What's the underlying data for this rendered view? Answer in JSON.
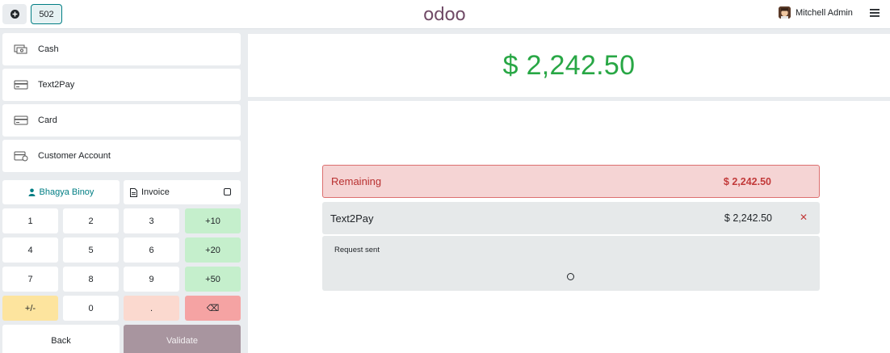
{
  "topbar": {
    "order_tab": "502",
    "logo": "odoo",
    "user_name": "Mitchell Admin",
    "icons": {
      "new_order": "plus-circle-icon",
      "menu": "hamburger-menu-icon",
      "avatar": "user-avatar"
    }
  },
  "payment_methods": [
    {
      "label": "Cash",
      "icon": "cash-register-icon"
    },
    {
      "label": "Text2Pay",
      "icon": "card-icon"
    },
    {
      "label": "Card",
      "icon": "card-icon"
    },
    {
      "label": "Customer Account",
      "icon": "customer-account-icon"
    }
  ],
  "customer": {
    "name": "Bhagya Binoy",
    "icon": "user-icon"
  },
  "invoice": {
    "label": "Invoice",
    "icon": "document-icon",
    "checked": false
  },
  "numpad": {
    "keys": [
      "1",
      "2",
      "3",
      "+10",
      "4",
      "5",
      "6",
      "+20",
      "7",
      "8",
      "9",
      "+50",
      "+/-",
      "0",
      ".",
      "⌫"
    ]
  },
  "actions": {
    "back": "Back",
    "validate": "Validate"
  },
  "total": "$ 2,242.50",
  "remaining": {
    "label": "Remaining",
    "amount": "$ 2,242.50"
  },
  "payment_line": {
    "method": "Text2Pay",
    "amount": "$ 2,242.50",
    "delete_icon": "close-icon"
  },
  "request": {
    "status": "Request sent"
  },
  "colors": {
    "accent": "#017e84",
    "total": "#28a745",
    "remaining_bg": "#f5d4d4",
    "validate_bg": "#a8959f",
    "plus_keys": "#c5efcc"
  }
}
